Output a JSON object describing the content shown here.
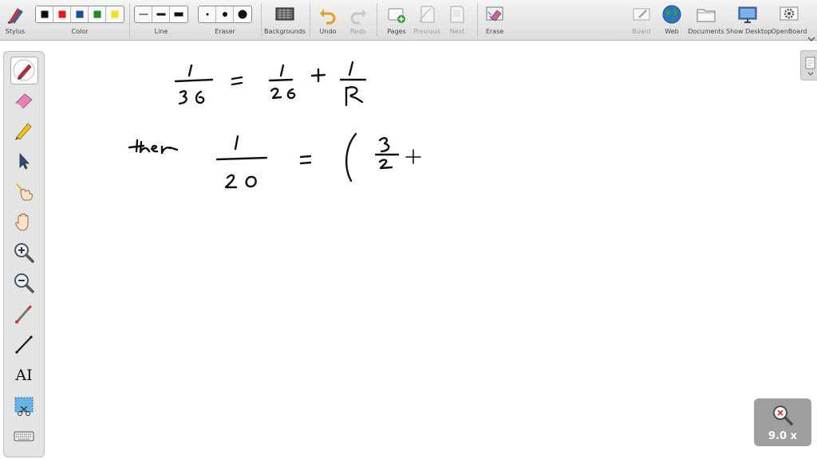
{
  "toolbar": {
    "stylus": "Stylus",
    "color": "Color",
    "line": "Line",
    "eraser": "Eraser",
    "backgrounds": "Backgrounds",
    "undo": "Undo",
    "redo": "Redo",
    "pages": "Pages",
    "previous": "Previous",
    "next": "Next",
    "erase": "Erase",
    "board": "Board",
    "web": "Web",
    "documents": "Documents",
    "show_desktop": "Show Desktop",
    "openboard": "OpenBoard"
  },
  "colors": {
    "swatches": [
      "#111111",
      "#e31b1b",
      "#1a4f9e",
      "#1b8a2a",
      "#f2e21b"
    ],
    "ink": "#111111",
    "toolbar_bg": "#e6e6e6"
  },
  "palette": {
    "tools": [
      "pen-icon",
      "eraser-icon",
      "highlighter-icon",
      "selector-icon",
      "interactor-icon",
      "hand-icon",
      "zoom-in-icon",
      "zoom-out-icon",
      "laser-pointer-icon",
      "line-icon",
      "text-icon",
      "capture-icon",
      "keyboard-icon"
    ],
    "text_tool_label": "AI"
  },
  "zoom": {
    "label": "9.0 x"
  }
}
